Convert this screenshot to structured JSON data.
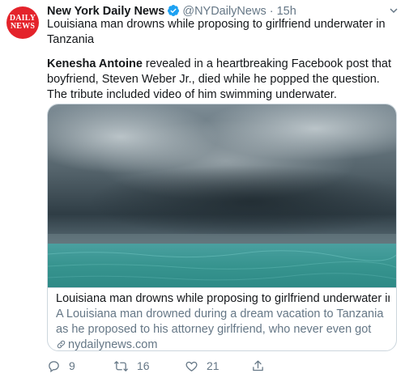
{
  "account": {
    "name": "New York Daily News",
    "handle": "@NYDailyNews",
    "separator": "·",
    "time": "15h",
    "avatar_text_line1": "DAILY",
    "avatar_text_line2": "NEWS"
  },
  "tweet": {
    "text": "Louisiana man drowns while proposing to girlfriend underwater in Tanzania",
    "desc_bold": "Kenesha Antoine",
    "desc_rest": " revealed in a heartbreaking Facebook post that boyfriend, Steven Weber Jr., died while he popped the question. The tribute included video of him swimming underwater."
  },
  "card": {
    "title": "Louisiana man drowns while proposing to girlfriend underwater in...",
    "description": "A Louisiana man drowned during a dream vacation to Tanzania as he proposed to his attorney girlfriend, who never even got the ...",
    "domain": "nydailynews.com"
  },
  "actions": {
    "replies": "9",
    "retweets": "16",
    "likes": "21"
  },
  "colors": {
    "brand_red": "#e4232b",
    "verified_blue": "#1da1f2",
    "muted": "#657786"
  }
}
